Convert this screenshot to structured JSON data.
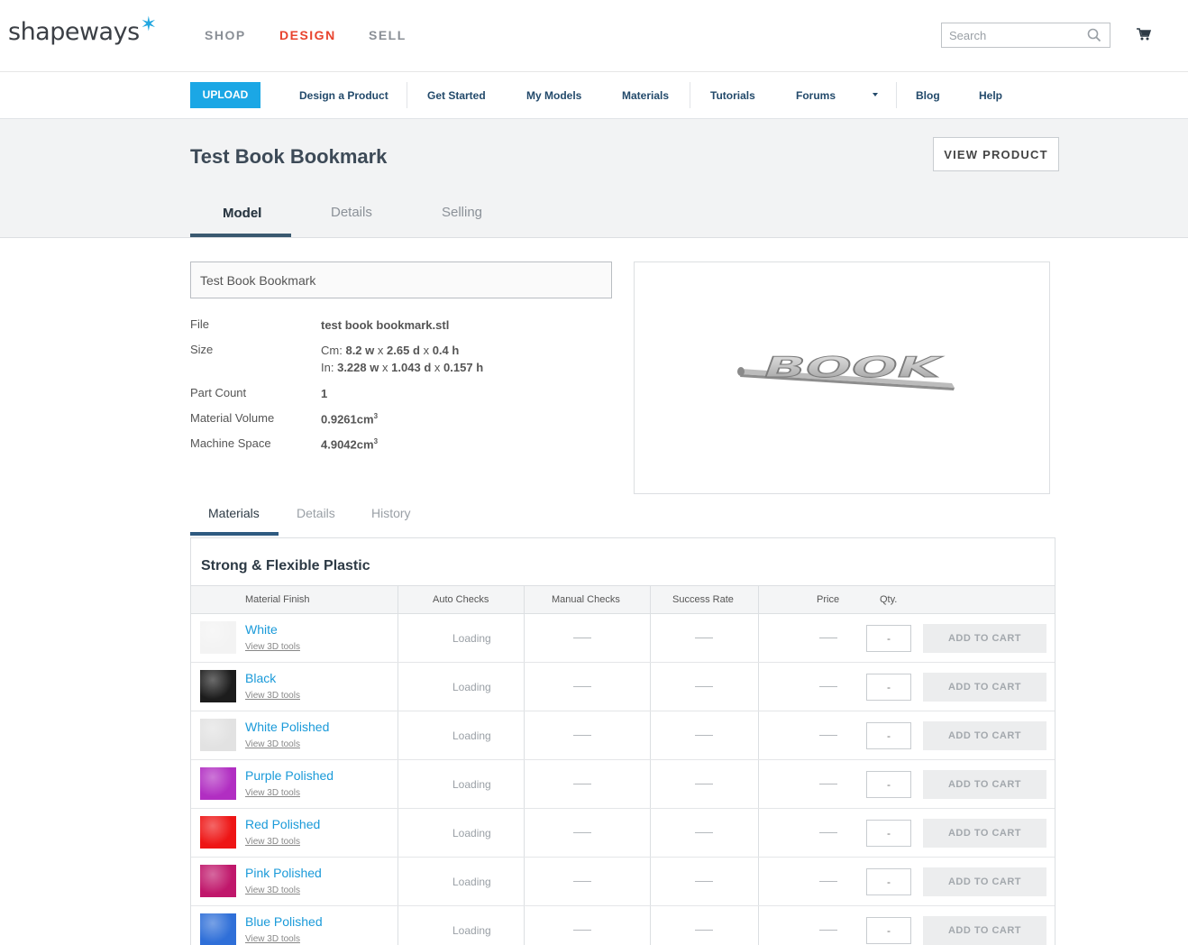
{
  "header": {
    "logo_text": "shapeways",
    "nav": [
      {
        "label": "SHOP",
        "active": false
      },
      {
        "label": "DESIGN",
        "active": true
      },
      {
        "label": "SELL",
        "active": false
      }
    ],
    "search_placeholder": "Search"
  },
  "subnav": {
    "upload_label": "UPLOAD",
    "items": [
      "Design a Product",
      "Get Started",
      "My Models",
      "Materials",
      "Tutorials",
      "Forums",
      "Blog",
      "Help"
    ]
  },
  "page": {
    "title": "Test Book Bookmark",
    "view_product_label": "VIEW PRODUCT",
    "tabs": [
      "Model",
      "Details",
      "Selling"
    ],
    "active_tab": "Model"
  },
  "model": {
    "name_value": "Test Book Bookmark",
    "file_label": "File",
    "file_value": "test book bookmark.stl",
    "size_label": "Size",
    "size_cm_prefix": "Cm:",
    "size_cm_w": "8.2",
    "size_cm_d": "2.65",
    "size_cm_h": "0.4",
    "size_in_prefix": "In:",
    "size_in_w": "3.228",
    "size_in_d": "1.043",
    "size_in_h": "0.157",
    "unit_w": "w",
    "unit_d": "d",
    "unit_h": "h",
    "times": "x",
    "part_count_label": "Part Count",
    "part_count_value": "1",
    "material_volume_label": "Material Volume",
    "material_volume_value": "0.9261cm",
    "machine_space_label": "Machine Space",
    "machine_space_value": "4.9042cm",
    "cubed": "3",
    "preview_text": "BOOK"
  },
  "lower_tabs": [
    "Materials",
    "Details",
    "History"
  ],
  "materials": {
    "group_title": "Strong & Flexible Plastic",
    "columns": [
      "Material Finish",
      "Auto Checks",
      "Manual Checks",
      "Success Rate",
      "Price",
      "Qty."
    ],
    "tools_label": "View 3D tools",
    "loading_label": "Loading",
    "qty_placeholder": "-",
    "add_to_cart_label": "ADD TO CART",
    "rows": [
      {
        "name": "White",
        "swatch": "#f3f3f3"
      },
      {
        "name": "Black",
        "swatch": "#1c1c1c"
      },
      {
        "name": "White Polished",
        "swatch": "#e2e2e2"
      },
      {
        "name": "Purple Polished",
        "swatch": "#b12ec2"
      },
      {
        "name": "Red Polished",
        "swatch": "#ee1515"
      },
      {
        "name": "Pink Polished",
        "swatch": "#c0176b"
      },
      {
        "name": "Blue Polished",
        "swatch": "#2f6fd8"
      }
    ]
  },
  "colors": {
    "brand_blue": "#1ba7e5",
    "design_red": "#e8432d",
    "link_blue": "#1a9ad9",
    "nav_navy": "#234a6b"
  },
  "icons": [
    "search-icon",
    "cart-icon",
    "chevron-down-icon",
    "logo-star-icon"
  ]
}
